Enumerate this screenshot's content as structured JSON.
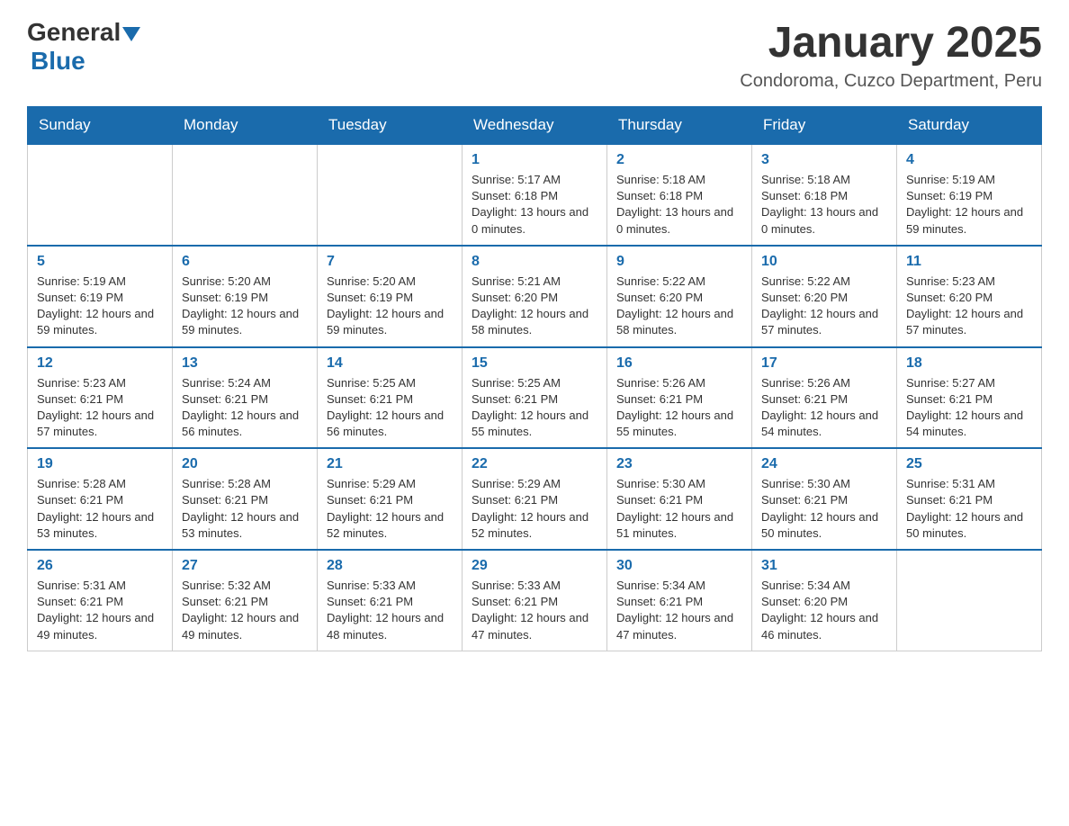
{
  "logo": {
    "general": "General",
    "blue": "Blue"
  },
  "title": "January 2025",
  "subtitle": "Condoroma, Cuzco Department, Peru",
  "days_of_week": [
    "Sunday",
    "Monday",
    "Tuesday",
    "Wednesday",
    "Thursday",
    "Friday",
    "Saturday"
  ],
  "weeks": [
    [
      {
        "day": "",
        "info": ""
      },
      {
        "day": "",
        "info": ""
      },
      {
        "day": "",
        "info": ""
      },
      {
        "day": "1",
        "info": "Sunrise: 5:17 AM\nSunset: 6:18 PM\nDaylight: 13 hours and 0 minutes."
      },
      {
        "day": "2",
        "info": "Sunrise: 5:18 AM\nSunset: 6:18 PM\nDaylight: 13 hours and 0 minutes."
      },
      {
        "day": "3",
        "info": "Sunrise: 5:18 AM\nSunset: 6:18 PM\nDaylight: 13 hours and 0 minutes."
      },
      {
        "day": "4",
        "info": "Sunrise: 5:19 AM\nSunset: 6:19 PM\nDaylight: 12 hours and 59 minutes."
      }
    ],
    [
      {
        "day": "5",
        "info": "Sunrise: 5:19 AM\nSunset: 6:19 PM\nDaylight: 12 hours and 59 minutes."
      },
      {
        "day": "6",
        "info": "Sunrise: 5:20 AM\nSunset: 6:19 PM\nDaylight: 12 hours and 59 minutes."
      },
      {
        "day": "7",
        "info": "Sunrise: 5:20 AM\nSunset: 6:19 PM\nDaylight: 12 hours and 59 minutes."
      },
      {
        "day": "8",
        "info": "Sunrise: 5:21 AM\nSunset: 6:20 PM\nDaylight: 12 hours and 58 minutes."
      },
      {
        "day": "9",
        "info": "Sunrise: 5:22 AM\nSunset: 6:20 PM\nDaylight: 12 hours and 58 minutes."
      },
      {
        "day": "10",
        "info": "Sunrise: 5:22 AM\nSunset: 6:20 PM\nDaylight: 12 hours and 57 minutes."
      },
      {
        "day": "11",
        "info": "Sunrise: 5:23 AM\nSunset: 6:20 PM\nDaylight: 12 hours and 57 minutes."
      }
    ],
    [
      {
        "day": "12",
        "info": "Sunrise: 5:23 AM\nSunset: 6:21 PM\nDaylight: 12 hours and 57 minutes."
      },
      {
        "day": "13",
        "info": "Sunrise: 5:24 AM\nSunset: 6:21 PM\nDaylight: 12 hours and 56 minutes."
      },
      {
        "day": "14",
        "info": "Sunrise: 5:25 AM\nSunset: 6:21 PM\nDaylight: 12 hours and 56 minutes."
      },
      {
        "day": "15",
        "info": "Sunrise: 5:25 AM\nSunset: 6:21 PM\nDaylight: 12 hours and 55 minutes."
      },
      {
        "day": "16",
        "info": "Sunrise: 5:26 AM\nSunset: 6:21 PM\nDaylight: 12 hours and 55 minutes."
      },
      {
        "day": "17",
        "info": "Sunrise: 5:26 AM\nSunset: 6:21 PM\nDaylight: 12 hours and 54 minutes."
      },
      {
        "day": "18",
        "info": "Sunrise: 5:27 AM\nSunset: 6:21 PM\nDaylight: 12 hours and 54 minutes."
      }
    ],
    [
      {
        "day": "19",
        "info": "Sunrise: 5:28 AM\nSunset: 6:21 PM\nDaylight: 12 hours and 53 minutes."
      },
      {
        "day": "20",
        "info": "Sunrise: 5:28 AM\nSunset: 6:21 PM\nDaylight: 12 hours and 53 minutes."
      },
      {
        "day": "21",
        "info": "Sunrise: 5:29 AM\nSunset: 6:21 PM\nDaylight: 12 hours and 52 minutes."
      },
      {
        "day": "22",
        "info": "Sunrise: 5:29 AM\nSunset: 6:21 PM\nDaylight: 12 hours and 52 minutes."
      },
      {
        "day": "23",
        "info": "Sunrise: 5:30 AM\nSunset: 6:21 PM\nDaylight: 12 hours and 51 minutes."
      },
      {
        "day": "24",
        "info": "Sunrise: 5:30 AM\nSunset: 6:21 PM\nDaylight: 12 hours and 50 minutes."
      },
      {
        "day": "25",
        "info": "Sunrise: 5:31 AM\nSunset: 6:21 PM\nDaylight: 12 hours and 50 minutes."
      }
    ],
    [
      {
        "day": "26",
        "info": "Sunrise: 5:31 AM\nSunset: 6:21 PM\nDaylight: 12 hours and 49 minutes."
      },
      {
        "day": "27",
        "info": "Sunrise: 5:32 AM\nSunset: 6:21 PM\nDaylight: 12 hours and 49 minutes."
      },
      {
        "day": "28",
        "info": "Sunrise: 5:33 AM\nSunset: 6:21 PM\nDaylight: 12 hours and 48 minutes."
      },
      {
        "day": "29",
        "info": "Sunrise: 5:33 AM\nSunset: 6:21 PM\nDaylight: 12 hours and 47 minutes."
      },
      {
        "day": "30",
        "info": "Sunrise: 5:34 AM\nSunset: 6:21 PM\nDaylight: 12 hours and 47 minutes."
      },
      {
        "day": "31",
        "info": "Sunrise: 5:34 AM\nSunset: 6:20 PM\nDaylight: 12 hours and 46 minutes."
      },
      {
        "day": "",
        "info": ""
      }
    ]
  ]
}
